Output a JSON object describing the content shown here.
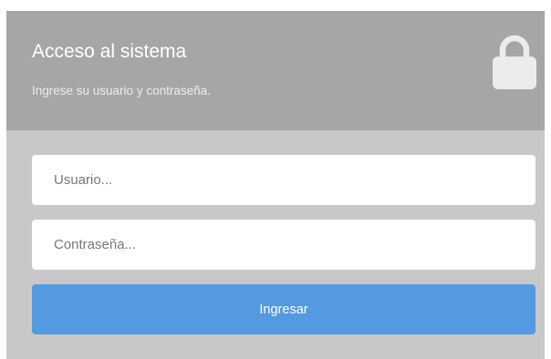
{
  "header": {
    "title": "Acceso al sistema",
    "subtitle": "Ingrese su usuario y contraseña.",
    "icon": "lock-icon"
  },
  "form": {
    "username": {
      "value": "",
      "placeholder": "Usuario..."
    },
    "password": {
      "value": "",
      "placeholder": "Contraseña..."
    },
    "submit_label": "Ingresar"
  },
  "colors": {
    "header_bg": "#a6a6a6",
    "body_bg": "#c8c8c8",
    "button_bg": "#549ae0",
    "input_bg": "#ffffff"
  }
}
